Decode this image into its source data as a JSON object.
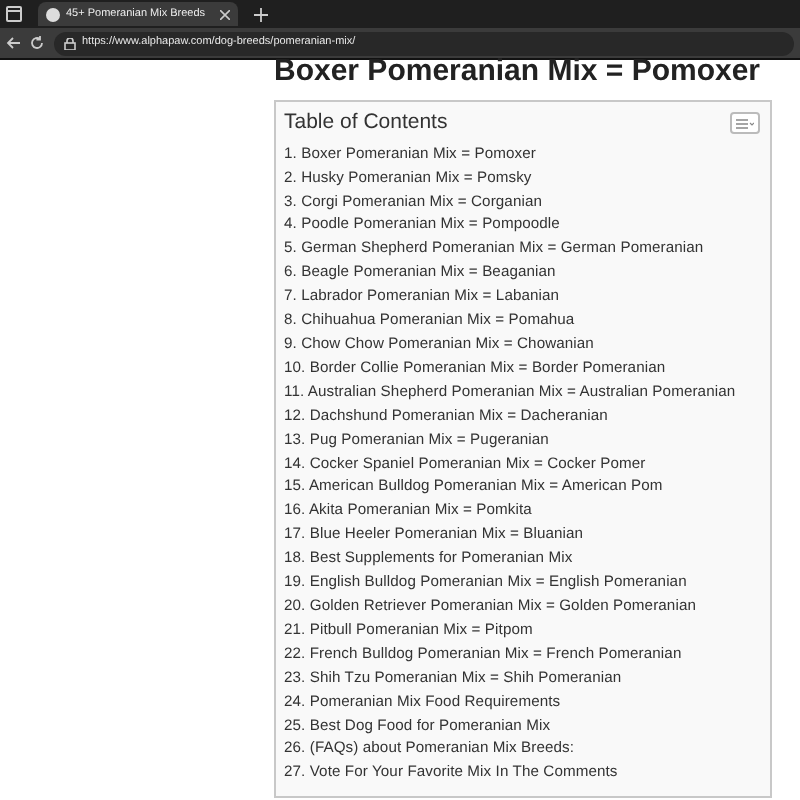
{
  "browser": {
    "tab": {
      "title": "45+ Pomeranian Mix Breeds",
      "selected": true
    },
    "url": "https://www.alphapaw.com/dog-breeds/pomeranian-mix/"
  },
  "heading": "Boxer Pomeranian Mix = Pomoxer",
  "toc": {
    "title": "Table of Contents",
    "items": [
      "1. Boxer Pomeranian Mix = Pomoxer",
      "2. Husky Pomeranian Mix = Pomsky",
      "3. Corgi Pomeranian Mix = Corganian",
      "4. Poodle Pomeranian Mix = Pompoodle",
      "5. German Shepherd Pomeranian Mix = German Pomeranian",
      "6. Beagle Pomeranian Mix = Beaganian",
      "7. Labrador Pomeranian Mix = Labanian",
      "8. Chihuahua Pomeranian Mix = Pomahua",
      "9. Chow Chow Pomeranian Mix = Chowanian",
      "10. Border Collie Pomeranian Mix = Border Pomeranian",
      "11. Australian Shepherd Pomeranian Mix = Australian Pomeranian",
      "12. Dachshund Pomeranian Mix = Dacheranian",
      "13. Pug Pomeranian Mix = Pugeranian",
      "14. Cocker Spaniel Pomeranian Mix = Cocker Pomer",
      "15. American Bulldog Pomeranian Mix = American Pom",
      "16. Akita Pomeranian Mix = Pomkita",
      "17. Blue Heeler Pomeranian Mix = Bluanian",
      "18. Best Supplements for Pomeranian Mix",
      "19. English Bulldog Pomeranian Mix = English Pomeranian",
      "20. Golden Retriever Pomeranian Mix = Golden Pomeranian",
      "21. Pitbull Pomeranian Mix = Pitpom",
      "22. French Bulldog Pomeranian Mix = French Pomeranian",
      "23. Shih Tzu Pomeranian Mix = Shih Pomeranian",
      "24. Pomeranian Mix Food Requirements",
      "25. Best Dog Food for Pomeranian Mix",
      "26. (FAQs) about Pomeranian Mix Breeds:",
      "27. Vote For Your Favorite Mix In The Comments"
    ]
  }
}
